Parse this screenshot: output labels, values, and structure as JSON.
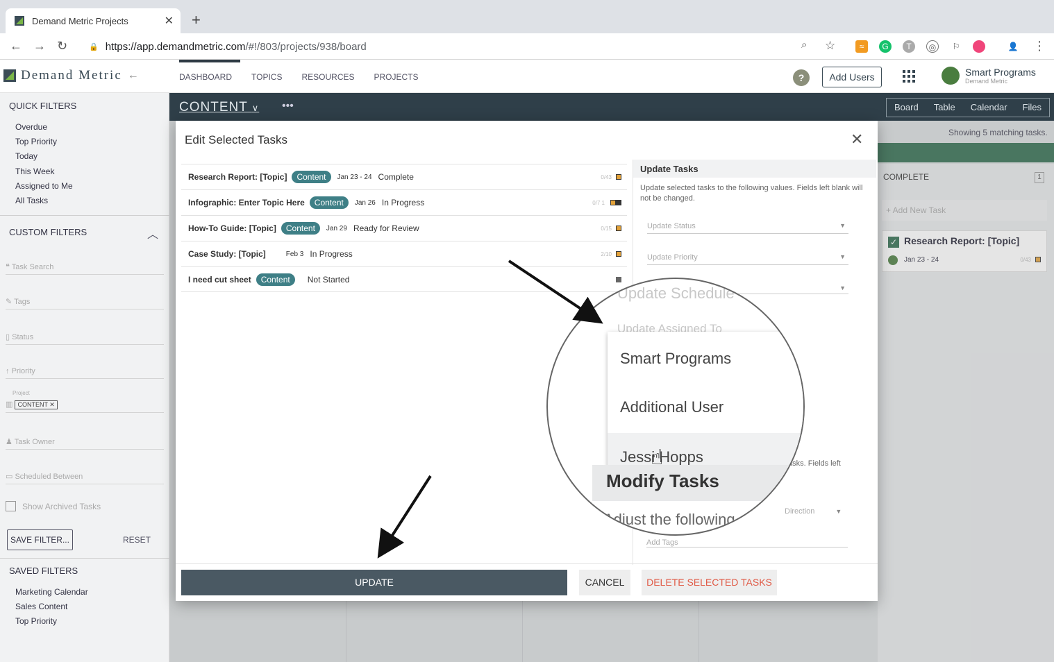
{
  "browser": {
    "tab_title": "Demand Metric Projects",
    "url_host": "https://app.demandmetric.com",
    "url_path": "/#!/803/projects/938/board"
  },
  "app": {
    "logo": "Demand Metric",
    "nav": [
      "DASHBOARD",
      "TOPICS",
      "RESOURCES",
      "PROJECTS"
    ],
    "add_users": "Add Users",
    "account_name": "Smart Programs",
    "account_sub": "Demand Metric"
  },
  "sidebar": {
    "quick_filters_title": "QUICK FILTERS",
    "quick_filters": [
      "Overdue",
      "Top Priority",
      "Today",
      "This Week",
      "Assigned to Me",
      "All Tasks"
    ],
    "custom_filters_title": "CUSTOM FILTERS",
    "task_search": "Task Search",
    "tags": "Tags",
    "status": "Status",
    "priority": "Priority",
    "project_label": "Project",
    "project_chip": "CONTENT",
    "task_owner": "Task Owner",
    "scheduled_between": "Scheduled Between",
    "show_archived": "Show Archived Tasks",
    "save_filter": "SAVE FILTER...",
    "reset": "RESET",
    "saved_filters_title": "SAVED FILTERS",
    "saved_filters": [
      "Marketing Calendar",
      "Sales Content",
      "Top Priority"
    ]
  },
  "board": {
    "title": "CONTENT",
    "views": [
      "Board",
      "Table",
      "Calendar",
      "Files"
    ],
    "showing": "Showing 5 matching tasks.",
    "complete_column": "COMPLETE",
    "complete_count": "1",
    "add_new_task": "+ Add New Task",
    "card_title": "Research Report: [Topic]",
    "card_date": "Jan 23 - 24",
    "card_meta": "0/43"
  },
  "modal": {
    "title": "Edit Selected Tasks",
    "tasks": [
      {
        "name": "Research Report: [Topic]",
        "badge": "Content",
        "date": "Jan 23 - 24",
        "status": "Complete",
        "meta": "0/43"
      },
      {
        "name": "Infographic: Enter Topic Here",
        "badge": "Content",
        "date": "Jan 26",
        "status": "In Progress",
        "meta": "0/7  1"
      },
      {
        "name": "How-To Guide: [Topic]",
        "badge": "Content",
        "date": "Jan 29",
        "status": "Ready for Review",
        "meta": "0/15"
      },
      {
        "name": "Case Study: [Topic]",
        "badge": "",
        "date": "Feb 3",
        "status": "In Progress",
        "meta": "2/10"
      },
      {
        "name": "I need cut sheet",
        "badge": "Content",
        "date": "",
        "status": "Not Started",
        "meta": ""
      }
    ],
    "update_title": "Update Tasks",
    "update_desc": "Update selected tasks to the following values. Fields left blank will not be changed.",
    "update_status": "Update Status",
    "update_priority": "Update Priority",
    "update_schedule": "Update Schedule",
    "update_assigned": "Update Assigned To",
    "assignees": [
      "Smart Programs",
      "Additional User",
      "Jessi Hopps"
    ],
    "modify_title": "Modify Tasks",
    "modify_desc_frag": "tasks. Fields left",
    "adjust_text": "Adjust the following",
    "direction": "Direction",
    "add_tags": "Add Tags",
    "update_btn": "UPDATE",
    "cancel_btn": "CANCEL",
    "delete_btn": "DELETE SELECTED TASKS"
  }
}
